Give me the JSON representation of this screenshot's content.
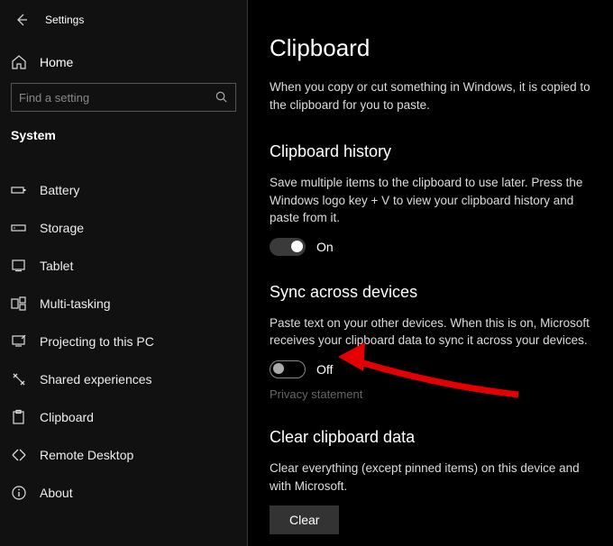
{
  "header": {
    "settings_label": "Settings",
    "home_label": "Home",
    "search_placeholder": "Find a setting",
    "current_section": "System"
  },
  "sidebar": {
    "items": [
      {
        "label": "Battery"
      },
      {
        "label": "Storage"
      },
      {
        "label": "Tablet"
      },
      {
        "label": "Multi-tasking"
      },
      {
        "label": "Projecting to this PC"
      },
      {
        "label": "Shared experiences"
      },
      {
        "label": "Clipboard"
      },
      {
        "label": "Remote Desktop"
      },
      {
        "label": "About"
      }
    ]
  },
  "main": {
    "title": "Clipboard",
    "intro": "When you copy or cut something in Windows, it is copied to the clipboard for you to paste.",
    "history": {
      "title": "Clipboard history",
      "desc": "Save multiple items to the clipboard to use later. Press the Windows logo key + V to view your clipboard history and paste from it.",
      "toggle_label": "On"
    },
    "sync": {
      "title": "Sync across devices",
      "desc": "Paste text on your other devices. When this is on, Microsoft receives your clipboard data to sync it across your devices.",
      "toggle_label": "Off",
      "privacy_label": "Privacy statement"
    },
    "clear": {
      "title": "Clear clipboard data",
      "desc": "Clear everything (except pinned items) on this device and with Microsoft.",
      "button_label": "Clear"
    }
  }
}
